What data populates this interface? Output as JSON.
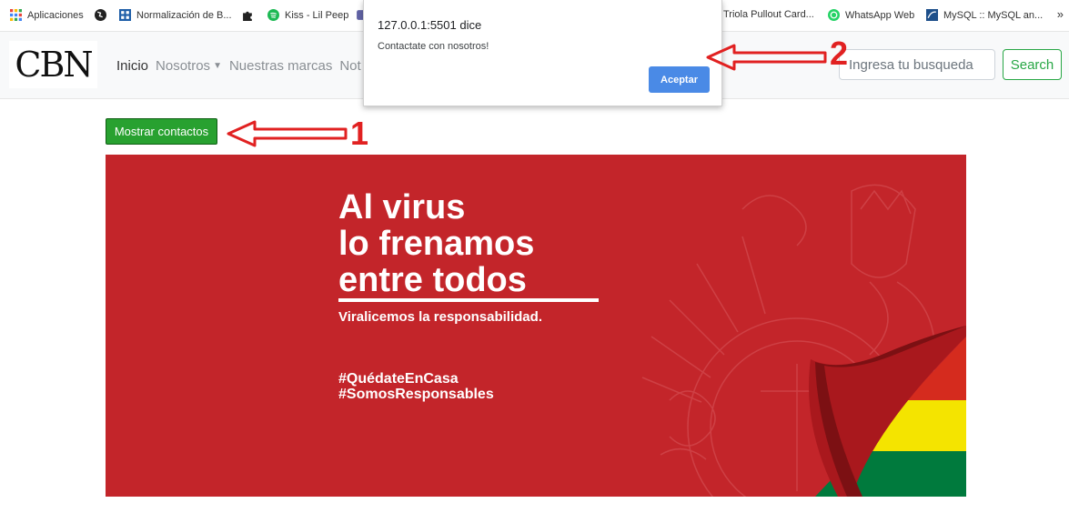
{
  "bookmarks": [
    {
      "label": "Aplicaciones",
      "icon": "apps-grid-icon"
    },
    {
      "label": "",
      "icon": "globe-icon"
    },
    {
      "label": "Normalización de B...",
      "icon": "bookmark-app-icon"
    },
    {
      "label": "",
      "icon": "puzzle-icon"
    },
    {
      "label": "Kiss - Lil Peep",
      "icon": "spotify-icon"
    },
    {
      "label": "",
      "icon": "bookmark-icon"
    },
    {
      "label": "Triola Pullout Card...",
      "icon": "page-icon"
    },
    {
      "label": "WhatsApp Web",
      "icon": "whatsapp-icon"
    },
    {
      "label": "MySQL :: MySQL an...",
      "icon": "mysql-icon"
    }
  ],
  "bookmarks_more": "»",
  "navbar": {
    "logo_text": "CBN",
    "links": [
      "Inicio",
      "Nosotros",
      "Nuestras marcas",
      "Not"
    ],
    "search_placeholder": "Ingresa tu busqueda",
    "search_button": "Search"
  },
  "dialog": {
    "title": "127.0.0.1:5501 dice",
    "message": "Contactate con nosotros!",
    "button": "Aceptar"
  },
  "contacts_button": "Mostrar contactos",
  "annotations": {
    "one": "1",
    "two": "2"
  },
  "banner": {
    "line1": "Al virus",
    "line2": "lo frenamos",
    "line3": "entre todos",
    "subtitle": "Viralicemos la responsabilidad.",
    "hashtag1": "#QuédateEnCasa",
    "hashtag2": "#SomosResponsables"
  },
  "colors": {
    "banner_red": "#c3252a",
    "search_green": "#28a745",
    "contacts_green": "#28a130",
    "dialog_blue": "#4a8ae6",
    "annotation_red": "#e12121",
    "flag_red": "#d52b1e",
    "flag_yellow": "#f4e400",
    "flag_green": "#007a3d"
  }
}
